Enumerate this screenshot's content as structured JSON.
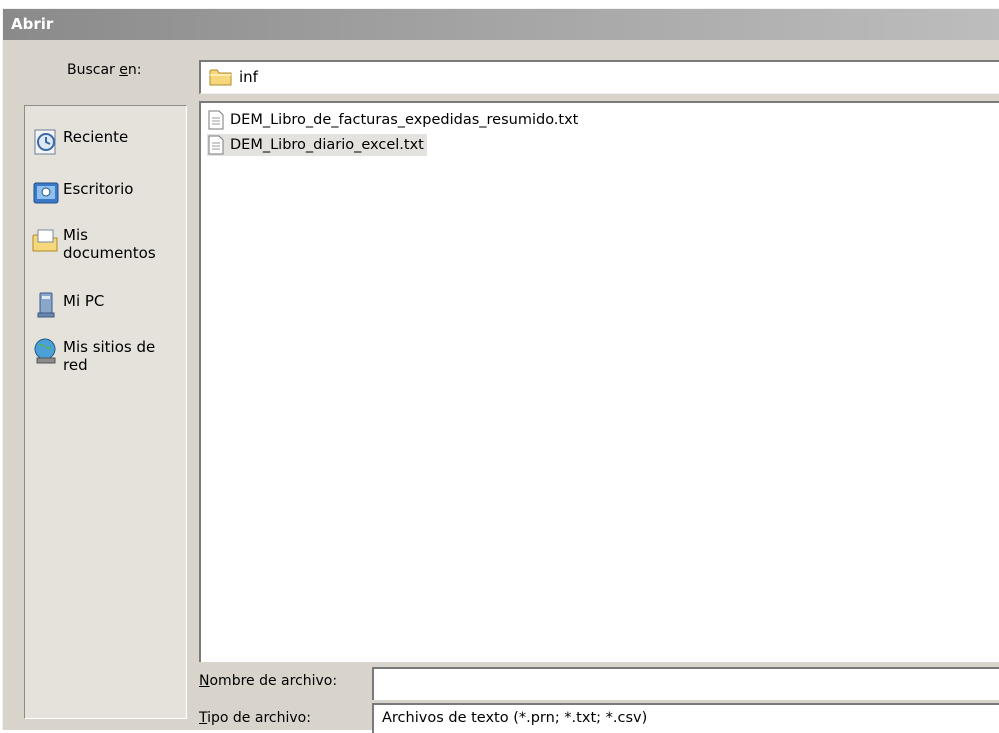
{
  "window": {
    "title": "Abrir"
  },
  "lookin": {
    "label_pre": "Buscar ",
    "label_key": "e",
    "label_post": "n:",
    "value": "inf"
  },
  "places": [
    {
      "label": "Reciente",
      "icon": "recent-documents-icon"
    },
    {
      "label": "Escritorio",
      "icon": "desktop-icon"
    },
    {
      "label": "Mis documentos",
      "icon": "my-documents-icon"
    },
    {
      "label": "Mi PC",
      "icon": "my-computer-icon"
    },
    {
      "label": "Mis sitios de red",
      "icon": "network-places-icon"
    }
  ],
  "files": [
    {
      "name": "DEM_Libro_de_facturas_expedidas_resumido.txt",
      "selected": false
    },
    {
      "name": "DEM_Libro_diario_excel.txt",
      "selected": true
    }
  ],
  "filename": {
    "label_key": "N",
    "label_rest": "ombre de archivo:",
    "value": ""
  },
  "filetype": {
    "label_key": "T",
    "label_rest": "ipo de archivo:",
    "value": "Archivos de texto (*.prn; *.txt; *.csv)"
  }
}
